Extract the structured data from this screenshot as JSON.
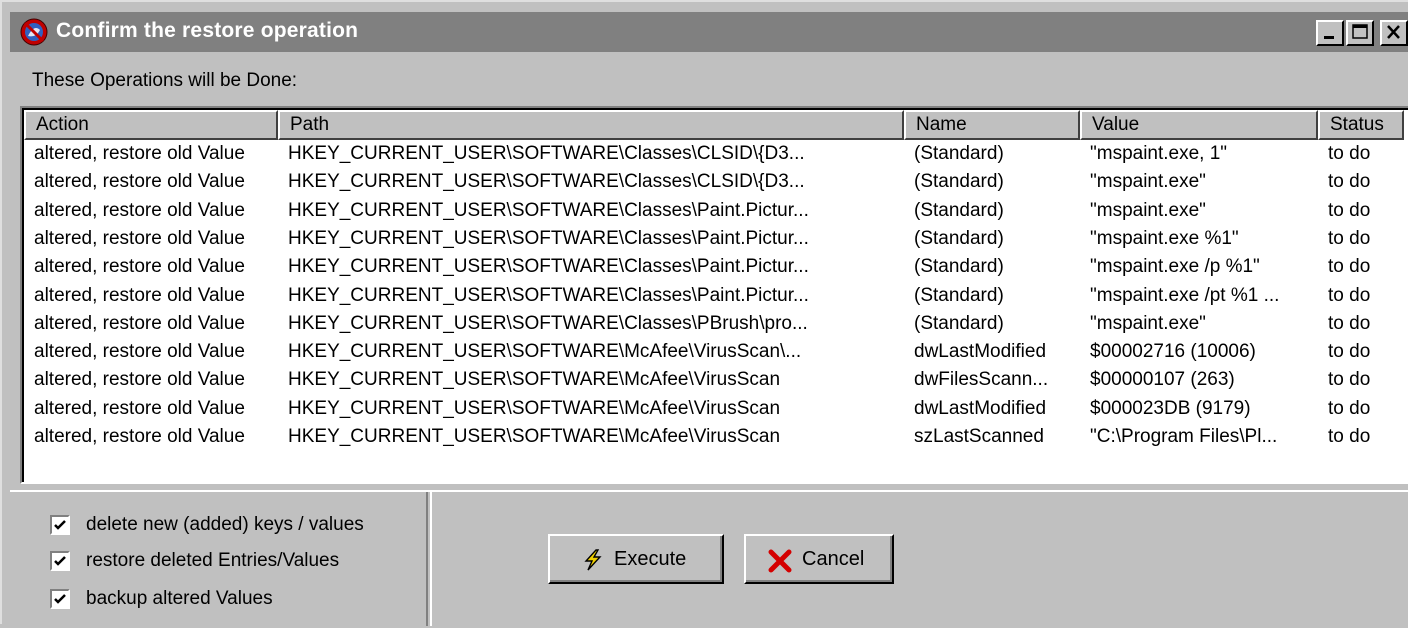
{
  "window": {
    "title": "Confirm the restore operation",
    "buttons": {
      "minimize": "_",
      "maximize": "□",
      "close": "×"
    }
  },
  "caption": "These Operations will be Done:",
  "table": {
    "columns": [
      "Action",
      "Path",
      "Name",
      "Value",
      "Status"
    ],
    "rows": [
      [
        "altered, restore old Value",
        "HKEY_CURRENT_USER\\SOFTWARE\\Classes\\CLSID\\{D3...",
        "(Standard)",
        "\"mspaint.exe, 1\"",
        "to do"
      ],
      [
        "altered, restore old Value",
        "HKEY_CURRENT_USER\\SOFTWARE\\Classes\\CLSID\\{D3...",
        "(Standard)",
        "\"mspaint.exe\"",
        "to do"
      ],
      [
        "altered, restore old Value",
        "HKEY_CURRENT_USER\\SOFTWARE\\Classes\\Paint.Pictur...",
        "(Standard)",
        "\"mspaint.exe\"",
        "to do"
      ],
      [
        "altered, restore old Value",
        "HKEY_CURRENT_USER\\SOFTWARE\\Classes\\Paint.Pictur...",
        "(Standard)",
        "\"mspaint.exe %1\"",
        "to do"
      ],
      [
        "altered, restore old Value",
        "HKEY_CURRENT_USER\\SOFTWARE\\Classes\\Paint.Pictur...",
        "(Standard)",
        "\"mspaint.exe /p %1\"",
        "to do"
      ],
      [
        "altered, restore old Value",
        "HKEY_CURRENT_USER\\SOFTWARE\\Classes\\Paint.Pictur...",
        "(Standard)",
        "\"mspaint.exe /pt %1 ...",
        "to do"
      ],
      [
        "altered, restore old Value",
        "HKEY_CURRENT_USER\\SOFTWARE\\Classes\\PBrush\\pro...",
        "(Standard)",
        "\"mspaint.exe\"",
        "to do"
      ],
      [
        "altered, restore old Value",
        "HKEY_CURRENT_USER\\SOFTWARE\\McAfee\\VirusScan\\...",
        "dwLastModified",
        "$00002716   (10006)",
        "to do"
      ],
      [
        "altered, restore old Value",
        "HKEY_CURRENT_USER\\SOFTWARE\\McAfee\\VirusScan",
        "dwFilesScann...",
        "$00000107   (263)",
        "to do"
      ],
      [
        "altered, restore old Value",
        "HKEY_CURRENT_USER\\SOFTWARE\\McAfee\\VirusScan",
        "dwLastModified",
        "$000023DB   (9179)",
        "to do"
      ],
      [
        "altered, restore old Value",
        "HKEY_CURRENT_USER\\SOFTWARE\\McAfee\\VirusScan",
        "szLastScanned",
        "\"C:\\Program Files\\Pl...",
        "to do"
      ]
    ]
  },
  "options": [
    {
      "label": "delete new (added) keys / values",
      "checked": true
    },
    {
      "label": "restore deleted Entries/Values",
      "checked": true
    },
    {
      "label": "backup altered Values",
      "checked": true
    }
  ],
  "buttons": {
    "execute": "Execute",
    "cancel": "Cancel"
  },
  "colors": {
    "titlebar_inactive": "#808080",
    "face": "#c0c0c0",
    "cancel_icon": "#d40000",
    "execute_icon": "#f0d000"
  },
  "icons": {
    "app": "app-icon",
    "execute": "lightning-icon",
    "cancel": "red-x-icon"
  }
}
